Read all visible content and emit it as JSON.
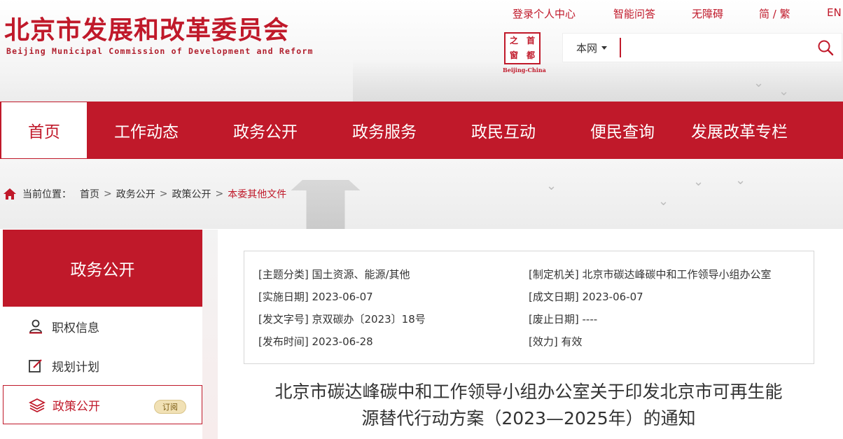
{
  "header": {
    "logo_cn": "北京市发展和改革委员会",
    "logo_en": "Beijing Municipal Commission of Development and Reform",
    "top_links": [
      "登录个人中心",
      "智能问答",
      "无障碍",
      "简 / 繁",
      "EN"
    ],
    "seal": {
      "chars": [
        "之",
        "首",
        "窗",
        "都"
      ],
      "subtitle": "Beijing-China"
    },
    "search": {
      "scope": "本网",
      "placeholder": ""
    }
  },
  "nav": {
    "items": [
      "首页",
      "工作动态",
      "政务公开",
      "政务服务",
      "政民互动",
      "便民查询",
      "发展改革专栏"
    ],
    "active_index": 0
  },
  "breadcrumb": {
    "label": "当前位置：",
    "items": [
      "首页",
      "政务公开",
      "政策公开",
      "本委其他文件"
    ]
  },
  "sidebar": {
    "title": "政务公开",
    "items": [
      {
        "label": "职权信息",
        "icon": "person-icon"
      },
      {
        "label": "规划计划",
        "icon": "edit-icon"
      },
      {
        "label": "政策公开",
        "icon": "layers-icon",
        "badge": "订阅"
      }
    ],
    "active_index": 2
  },
  "info": {
    "topic": {
      "label": "[主题分类]",
      "value": "国土资源、能源/其他"
    },
    "issuer": {
      "label": "[制定机关]",
      "value": "北京市碳达峰碳中和工作领导小组办公室"
    },
    "effective_date": {
      "label": "[实施日期]",
      "value": "2023-06-07"
    },
    "written_date": {
      "label": "[成文日期]",
      "value": "2023-06-07"
    },
    "doc_number": {
      "label": "[发文字号]",
      "value": "京双碳办〔2023〕18号"
    },
    "expiry_date": {
      "label": "[废止日期]",
      "value": "----"
    },
    "publish_date": {
      "label": "[发布时间]",
      "value": "2023-06-28"
    },
    "validity": {
      "label": "[效力]",
      "value": "有效"
    }
  },
  "document": {
    "title_line1": "北京市碳达峰碳中和工作领导小组办公室关于印发北京市可再生能",
    "title_line2": "源替代行动方案（2023—2025年）的通知"
  },
  "colors": {
    "brand_red": "#c0192a"
  }
}
